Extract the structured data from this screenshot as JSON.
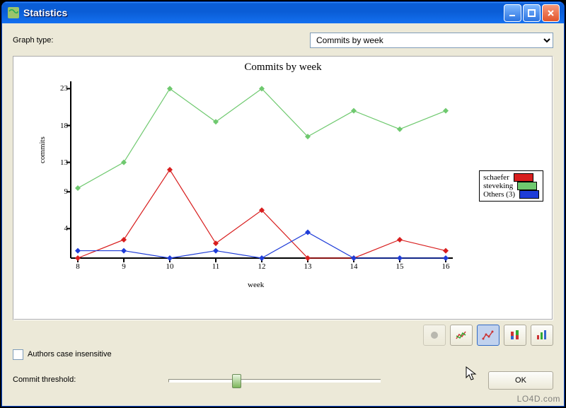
{
  "window": {
    "title": "Statistics"
  },
  "controls": {
    "graph_type_label": "Graph type:",
    "graph_type_value": "Commits by week",
    "authors_case_label": "Authors case insensitive",
    "commit_threshold_label": "Commit threshold:",
    "ok_label": "OK"
  },
  "watermark": "LO4D.com",
  "chart_data": {
    "type": "line",
    "title": "Commits by week",
    "xlabel": "week",
    "ylabel": "commits",
    "x": [
      8,
      9,
      10,
      11,
      12,
      13,
      14,
      15,
      16
    ],
    "yticks": [
      4,
      9,
      13,
      18,
      23
    ],
    "xlim": [
      8,
      16
    ],
    "ylim": [
      0,
      24
    ],
    "series": [
      {
        "name": "schaefer",
        "color": "#d81e1e",
        "values": [
          0,
          2.5,
          12,
          2,
          6.5,
          0,
          0,
          2.5,
          1
        ]
      },
      {
        "name": "steveking",
        "color": "#6fc96f",
        "values": [
          9.5,
          13,
          23,
          18.5,
          23,
          16.5,
          20,
          17.5,
          20
        ]
      },
      {
        "name": "Others (3)",
        "color": "#1e3cd8",
        "values": [
          1,
          1,
          0,
          1,
          0,
          3.5,
          0,
          0,
          0
        ]
      }
    ]
  }
}
